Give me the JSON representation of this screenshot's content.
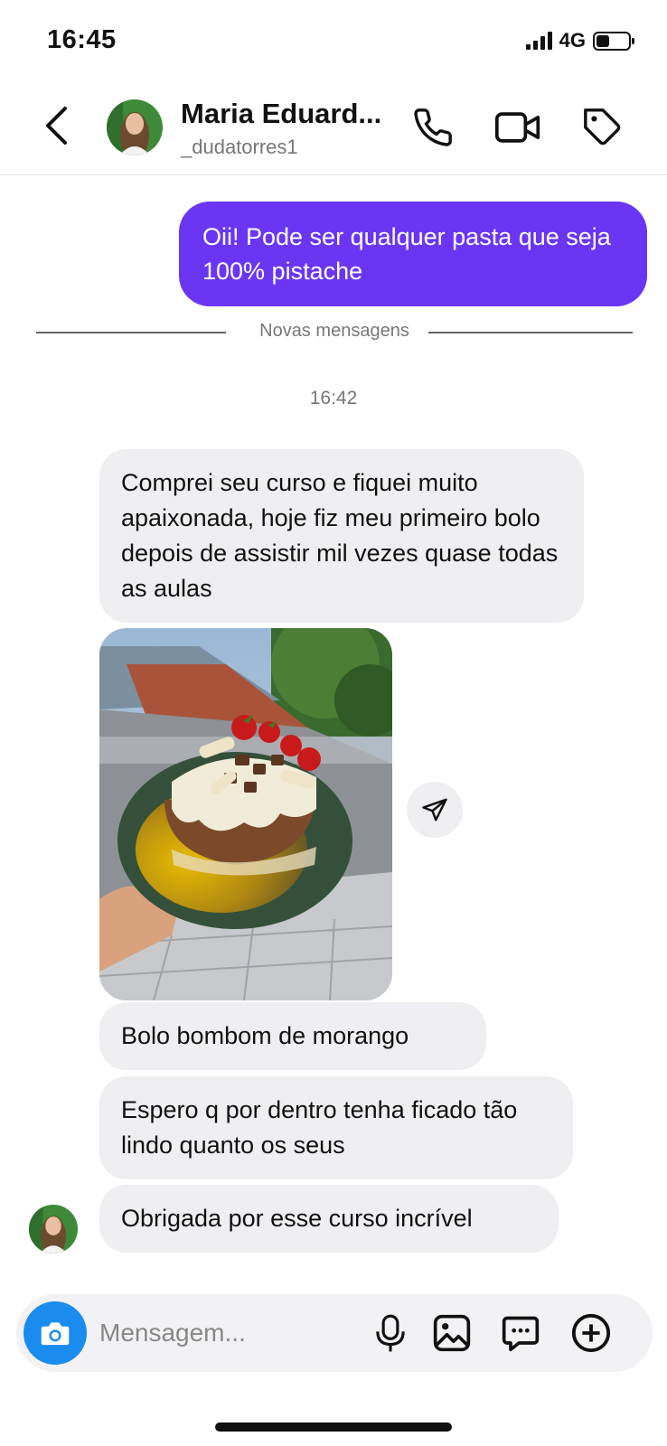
{
  "status_bar": {
    "time": "16:45",
    "network": "4G",
    "battery_level": 0.4
  },
  "header": {
    "name": "Maria Eduard...",
    "username": "_dudatorres1",
    "icons": [
      "back-icon",
      "phone-icon",
      "video-icon",
      "tag-icon"
    ]
  },
  "chat": {
    "outgoing_message": "Oii! Pode ser qualquer pasta que seja 100% pistache",
    "divider_label": "Novas mensagens",
    "timestamp": "16:42",
    "incoming": [
      "Comprei seu curso e fiquei muito apaixonada, hoje fiz meu primeiro bolo depois de assistir mil vezes quase todas as aulas",
      "Bolo bombom de morango",
      "Espero q por dentro tenha ficado tão lindo quanto os seus",
      "Obrigada por esse curso incrível"
    ]
  },
  "composer": {
    "placeholder": "Mensagem...",
    "icons": [
      "camera-icon",
      "microphone-icon",
      "gallery-icon",
      "sticker-icon",
      "plus-icon"
    ]
  },
  "colors": {
    "outgoing_bubble": "#6a36f4",
    "incoming_bubble": "#efeff2",
    "camera_button": "#1a8cf0"
  }
}
